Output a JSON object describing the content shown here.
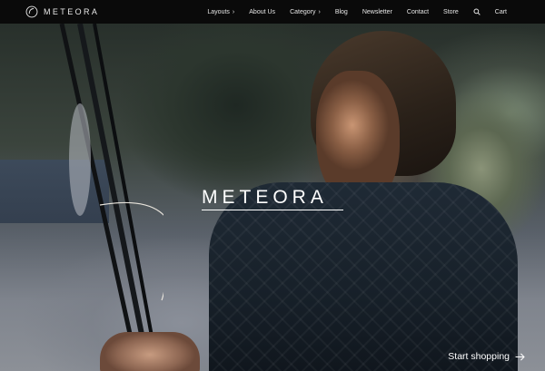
{
  "brand": {
    "name": "METEORA",
    "logo_icon": "circle-logo-icon"
  },
  "nav": {
    "items": [
      {
        "label": "Layouts",
        "has_chevron": true
      },
      {
        "label": "About Us",
        "has_chevron": false
      },
      {
        "label": "Category",
        "has_chevron": true
      },
      {
        "label": "Blog",
        "has_chevron": false
      },
      {
        "label": "Newsletter",
        "has_chevron": false
      },
      {
        "label": "Contact",
        "has_chevron": false
      },
      {
        "label": "Store",
        "has_chevron": false
      }
    ],
    "search_icon": "search-icon",
    "cart_label": "Cart",
    "chevron_glyph": "›"
  },
  "hero": {
    "title": "METEORA",
    "cta_label": "Start shopping",
    "cta_icon": "arrow-right-icon"
  },
  "colors": {
    "nav_bg": "#0a0a0a",
    "text_light": "#ffffff"
  }
}
